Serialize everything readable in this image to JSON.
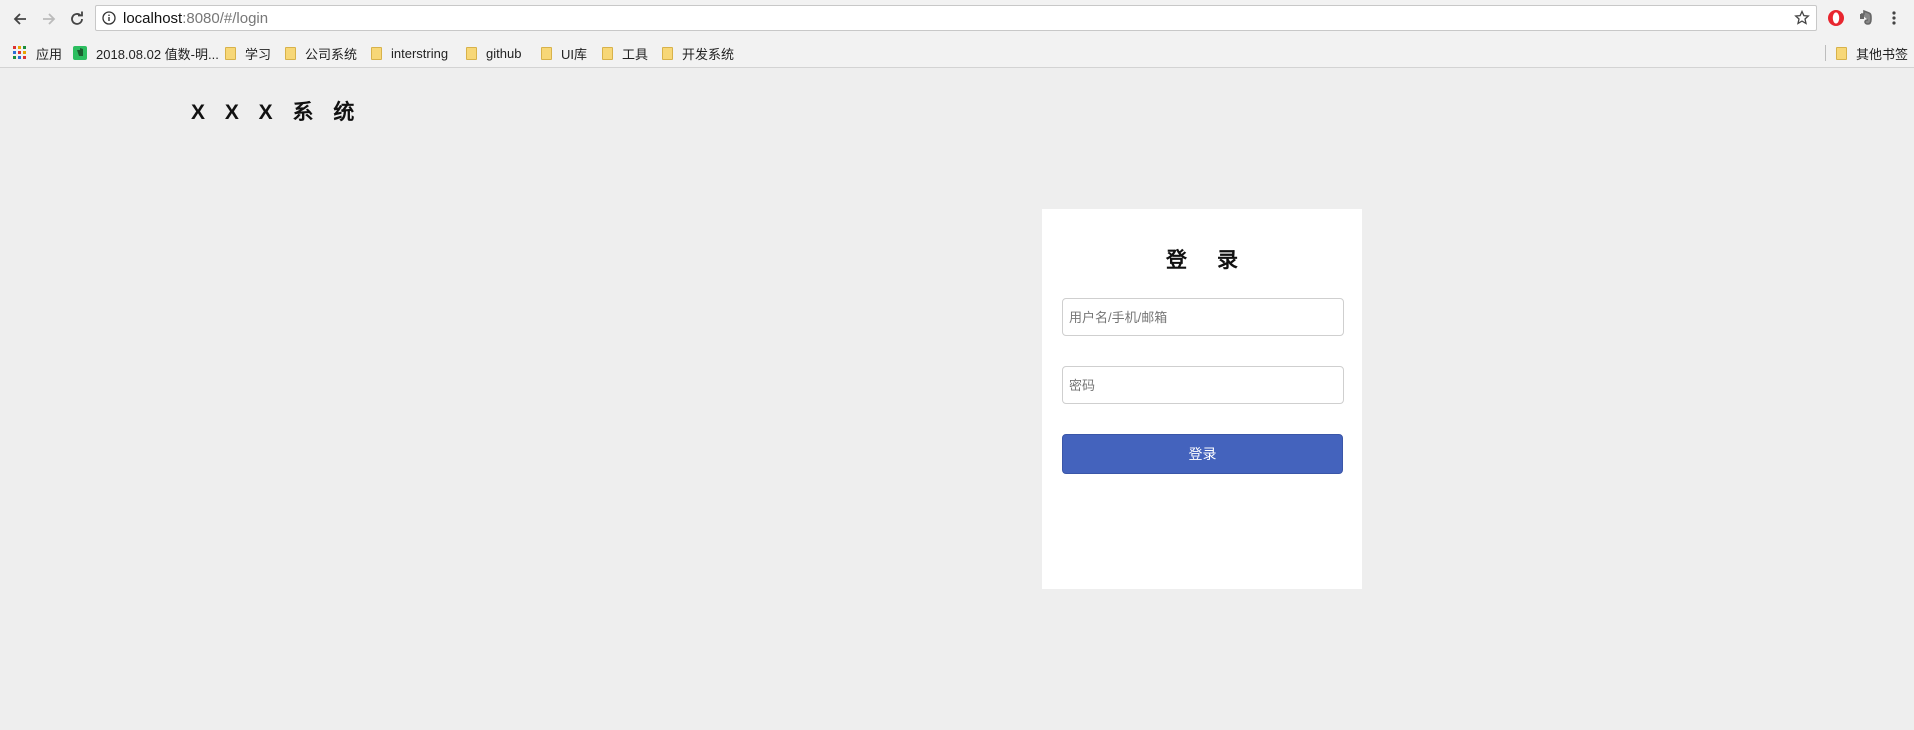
{
  "browser": {
    "url_host": "localhost",
    "url_rest": ":8080/#/login"
  },
  "bookmarks": {
    "apps_label": "应用",
    "items": [
      "2018.08.02 值数-明...",
      "学习",
      "公司系统",
      "interstring",
      "github",
      "UI库",
      "工具",
      "开发系统"
    ],
    "other_label": "其他书签"
  },
  "page": {
    "system_title": "X X X 系 统"
  },
  "login": {
    "title": "登录",
    "username_placeholder": "用户名/手机/邮箱",
    "password_placeholder": "密码",
    "submit_label": "登录",
    "accent_color": "#4463bd"
  }
}
